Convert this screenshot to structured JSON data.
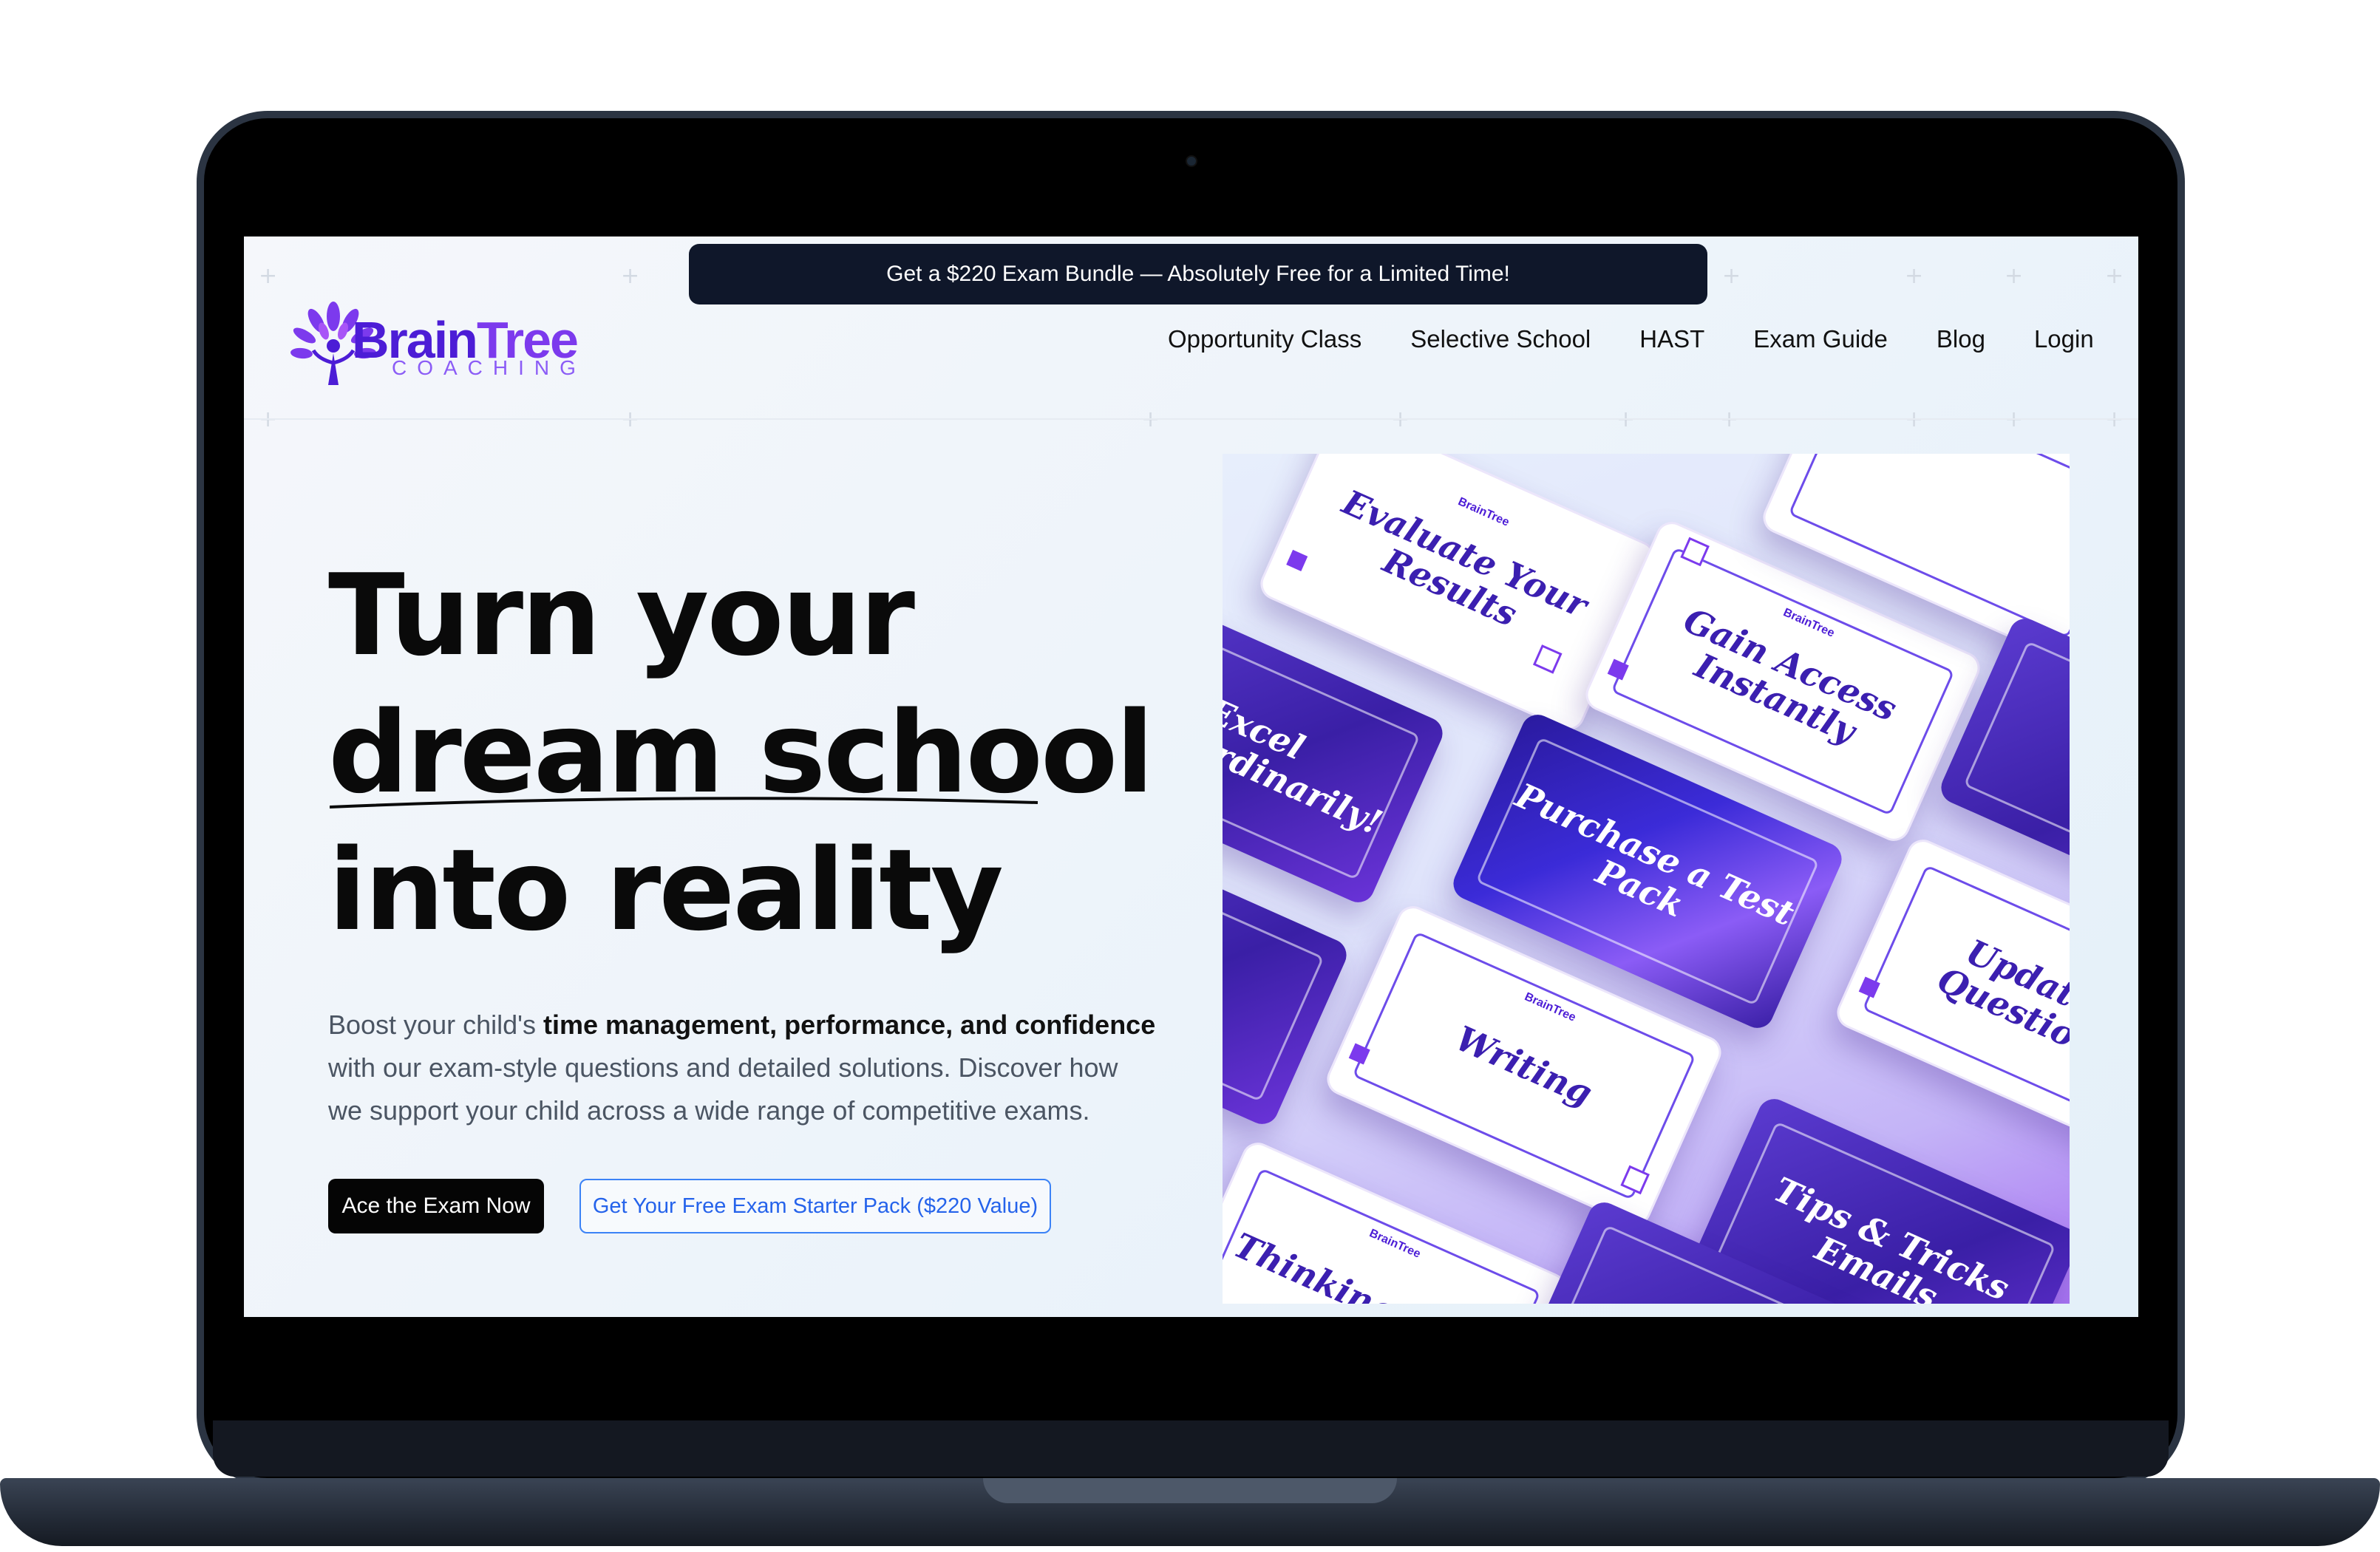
{
  "promo_banner": "Get a $220 Exam Bundle — Absolutely Free for a Limited Time!",
  "logo": {
    "name": "BrainTree",
    "name_part1": "Brain",
    "name_part2": "Tree",
    "tagline": "COACHING"
  },
  "nav": [
    "Opportunity Class",
    "Selective School",
    "HAST",
    "Exam Guide",
    "Blog",
    "Login"
  ],
  "hero": {
    "line1": "Turn your",
    "line2": "dream school",
    "line3": "into reality",
    "para_start": "Boost your child's ",
    "para_bold": "time management, performance, and confidence",
    "para_rest": " with our exam-style questions and detailed solutions. Discover how we support your child across a wide range of competitive exams.",
    "cta_primary": "Ace the Exam Now",
    "cta_secondary": "Get Your Free Exam Starter Pack ($220 Value)"
  },
  "cards": {
    "evaluate": "Evaluate Your Results",
    "gain": "Gain Access Instantly",
    "excel": "Excel Extraordinarily!",
    "purchase": "Purchase a Test Pack",
    "writing": "Writing",
    "updated": "Updated Questions",
    "thinking": "Thinking Skills",
    "tips": "Tips & Tricks Emails",
    "mini_logo": "BrainTree"
  },
  "colors": {
    "brand": "#4c1dd6",
    "accent": "#7c3aed",
    "promo_bg": "#0f172a",
    "link": "#2563eb"
  }
}
